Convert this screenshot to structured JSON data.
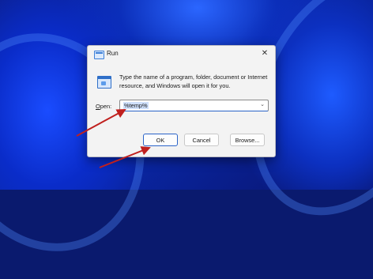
{
  "dialog": {
    "title": "Run",
    "close_glyph": "✕",
    "description": "Type the name of a program, folder, document or Internet resource, and Windows will open it for you.",
    "open_label_underlined": "O",
    "open_label_rest": "pen:",
    "open_value": "%temp%",
    "combo_arrow": "⌄",
    "buttons": {
      "ok": "OK",
      "cancel": "Cancel",
      "browse": "Browse..."
    }
  },
  "colors": {
    "annotation_arrow": "#c0201e",
    "accent": "#2b64c8",
    "wallpaper": "#0a2ab0"
  },
  "icons": {
    "run_title_icon": "run-window-icon",
    "run_big_icon": "run-app-icon",
    "close": "close-icon"
  }
}
